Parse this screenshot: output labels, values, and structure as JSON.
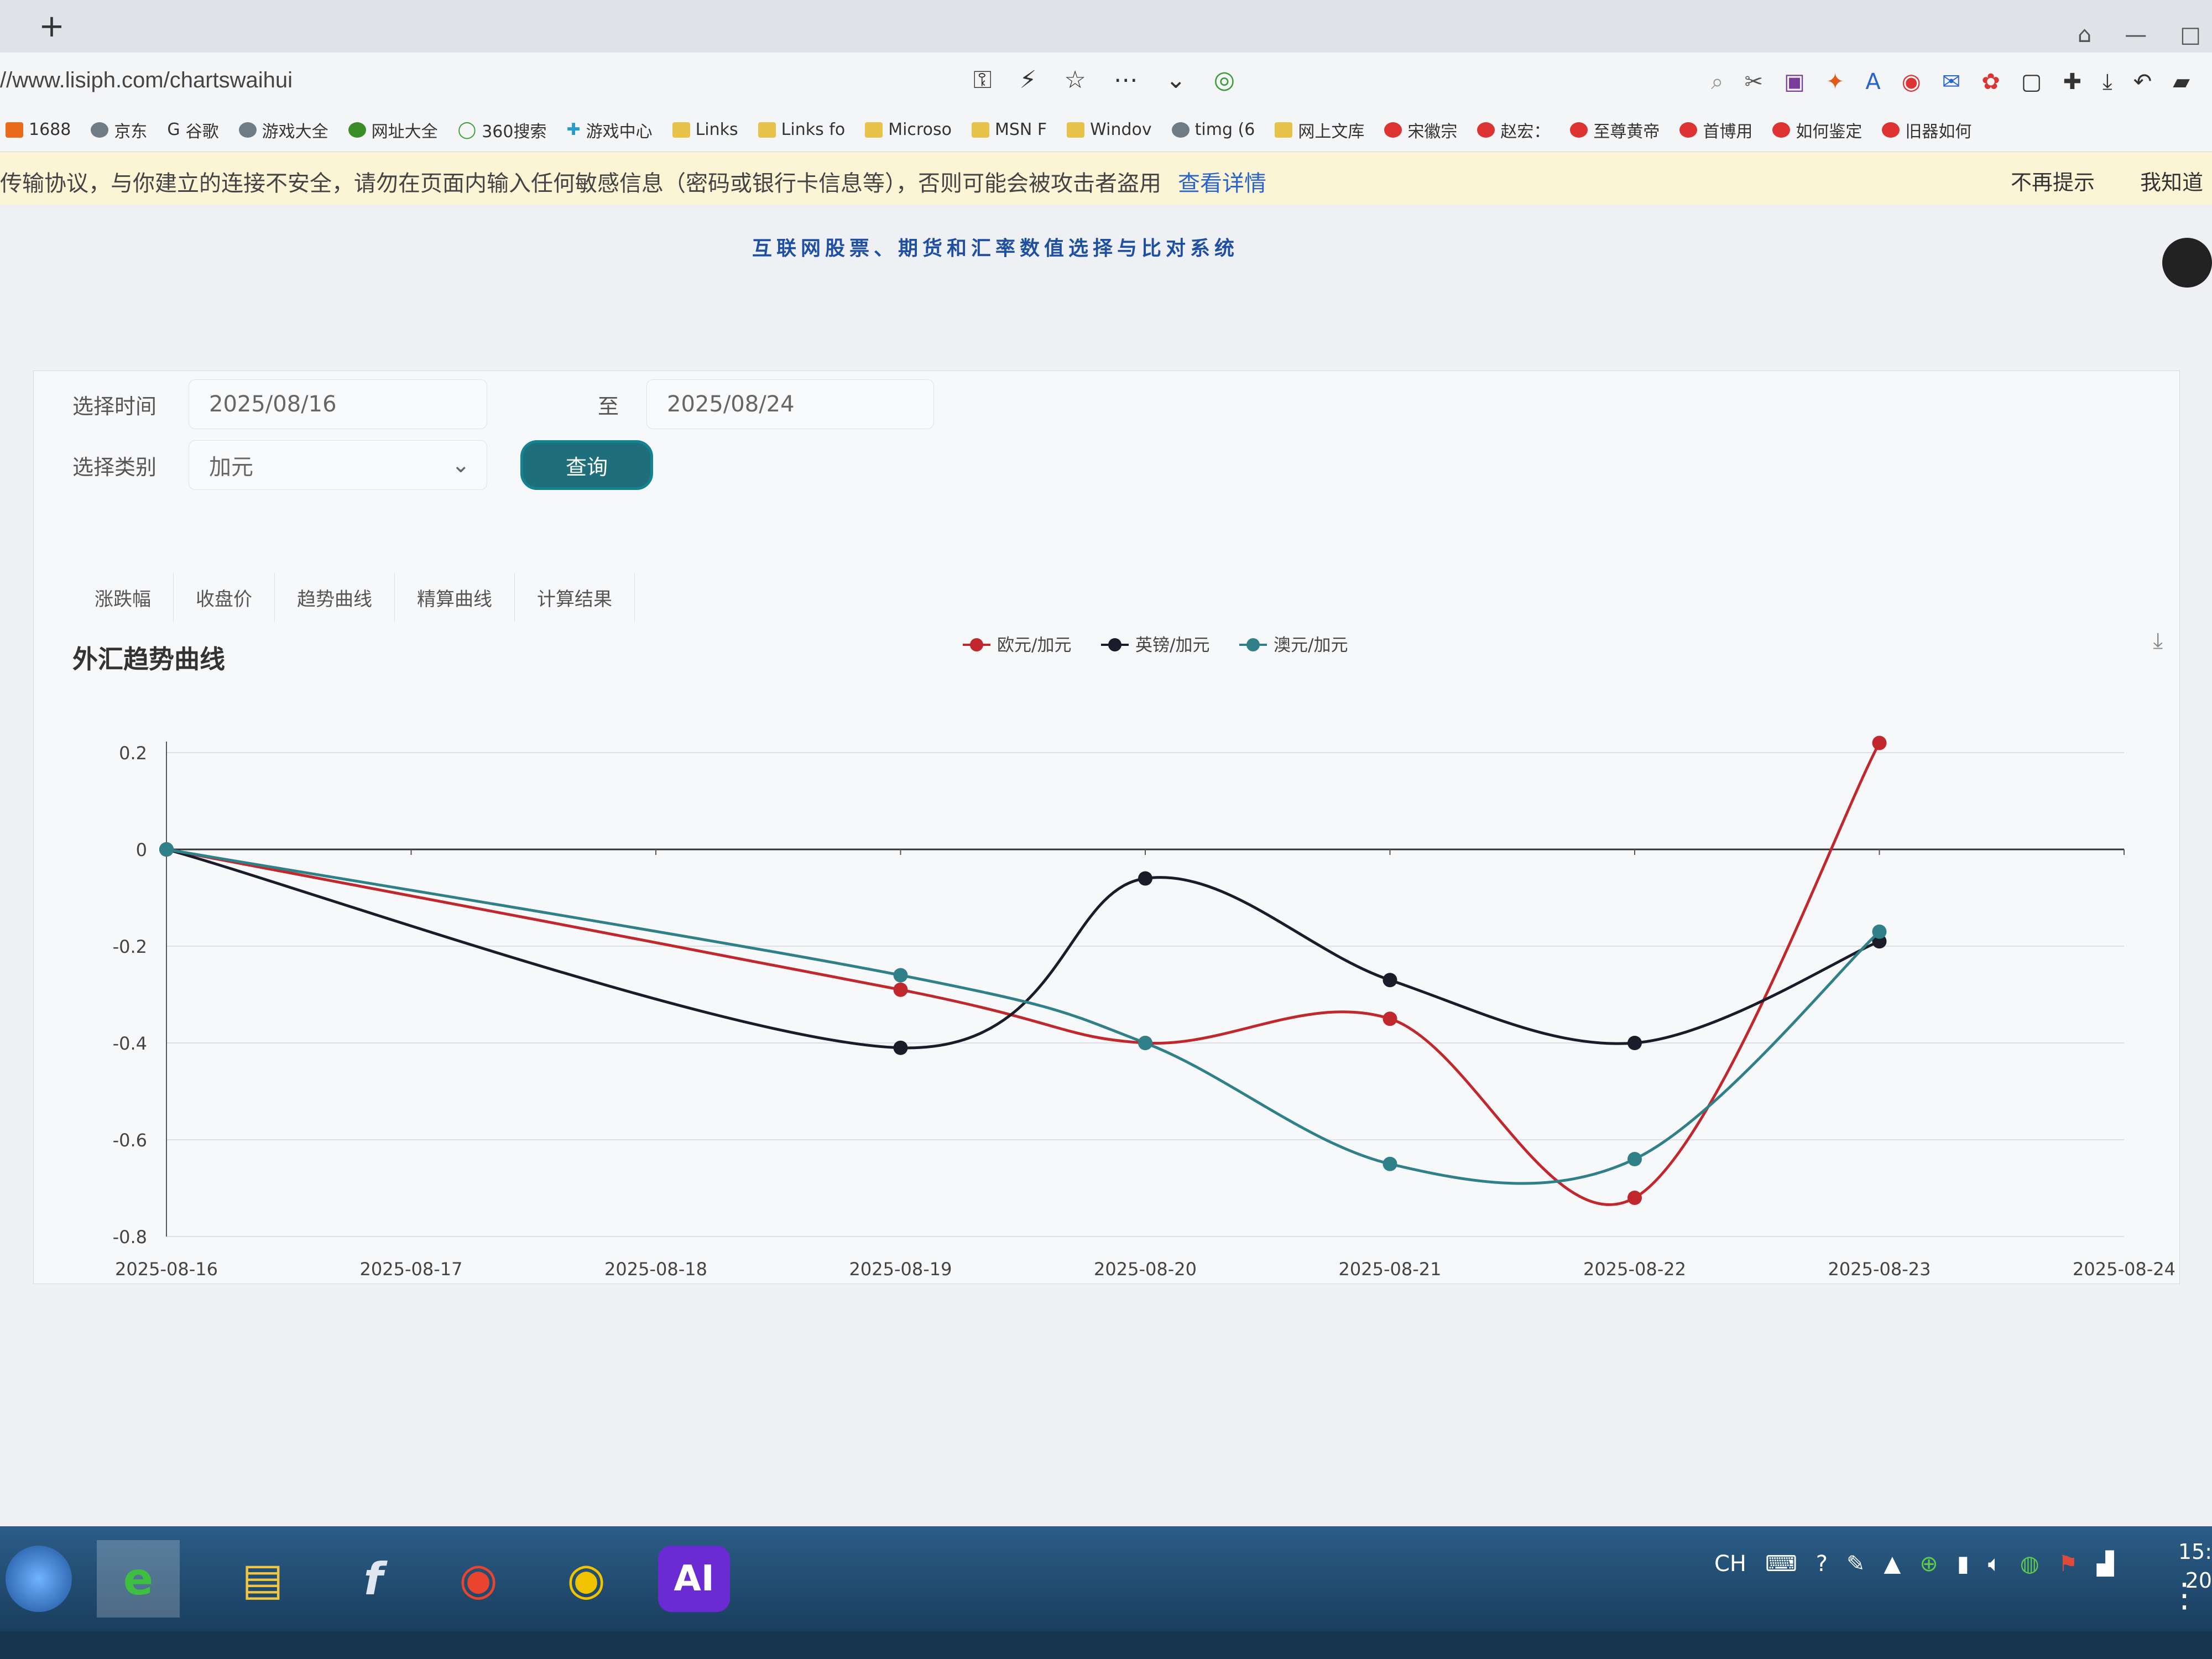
{
  "browser": {
    "new_tab": "+",
    "url": "//www.lisiph.com/chartswaihui",
    "bookmarks": [
      "1688",
      "京东",
      "谷歌",
      "游戏大全",
      "网址大全",
      "360搜索",
      "游戏中心",
      "Links",
      "Links fo",
      "Microso",
      "MSN F",
      "Windov",
      "timg (6",
      "网上文库",
      "宋徽宗",
      "赵宏：",
      "至尊黄帝",
      "首博用",
      "如何鉴定",
      "旧器如何"
    ],
    "warning": "传输协议，与你建立的连接不安全，请勿在页面内输入任何敏感信息（密码或银行卡信息等），否则可能会被攻击者盗用",
    "warning_link": "查看详情",
    "warning_dismiss": "不再提示",
    "warning_ok": "我知道"
  },
  "page": {
    "site_title": "互联网股票、期货和汇率数值选择与比对系统",
    "form": {
      "time_label": "选择时间",
      "start_date": "2025/08/16",
      "to_label": "至",
      "end_date": "2025/08/24",
      "category_label": "选择类别",
      "category_value": "加元",
      "query_button": "查询"
    },
    "tabs": [
      "涨跌幅",
      "收盘价",
      "趋势曲线",
      "精算曲线",
      "计算结果"
    ],
    "chart_title": "外汇趋势曲线"
  },
  "chart_data": {
    "type": "line",
    "title": "外汇趋势曲线",
    "x": [
      "2025-08-16",
      "2025-08-17",
      "2025-08-18",
      "2025-08-19",
      "2025-08-20",
      "2025-08-21",
      "2025-08-22",
      "2025-08-23",
      "2025-08-24"
    ],
    "ylim": [
      -0.8,
      0.2
    ],
    "yticks": [
      "0.2",
      "0",
      "-0.2",
      "-0.4",
      "-0.6",
      "-0.8"
    ],
    "legend_position": "top-center",
    "smooth": true,
    "series": [
      {
        "name": "欧元/加元",
        "color": "#c0282d",
        "points": [
          [
            "2025-08-16",
            0
          ],
          [
            "2025-08-19",
            -0.29
          ],
          [
            "2025-08-20",
            -0.4
          ],
          [
            "2025-08-21",
            -0.35
          ],
          [
            "2025-08-22",
            -0.72
          ],
          [
            "2025-08-23",
            0.22
          ]
        ]
      },
      {
        "name": "英镑/加元",
        "color": "#1b1b2a",
        "points": [
          [
            "2025-08-16",
            0
          ],
          [
            "2025-08-19",
            -0.41
          ],
          [
            "2025-08-20",
            -0.06
          ],
          [
            "2025-08-21",
            -0.27
          ],
          [
            "2025-08-22",
            -0.4
          ],
          [
            "2025-08-23",
            -0.19
          ]
        ]
      },
      {
        "name": "澳元/加元",
        "color": "#2f8088",
        "points": [
          [
            "2025-08-16",
            0
          ],
          [
            "2025-08-19",
            -0.26
          ],
          [
            "2025-08-20",
            -0.4
          ],
          [
            "2025-08-21",
            -0.65
          ],
          [
            "2025-08-22",
            -0.64
          ],
          [
            "2025-08-23",
            -0.17
          ]
        ]
      }
    ]
  },
  "taskbar": {
    "ime": "CH",
    "time_top": "15:",
    "time_bottom": "20"
  }
}
